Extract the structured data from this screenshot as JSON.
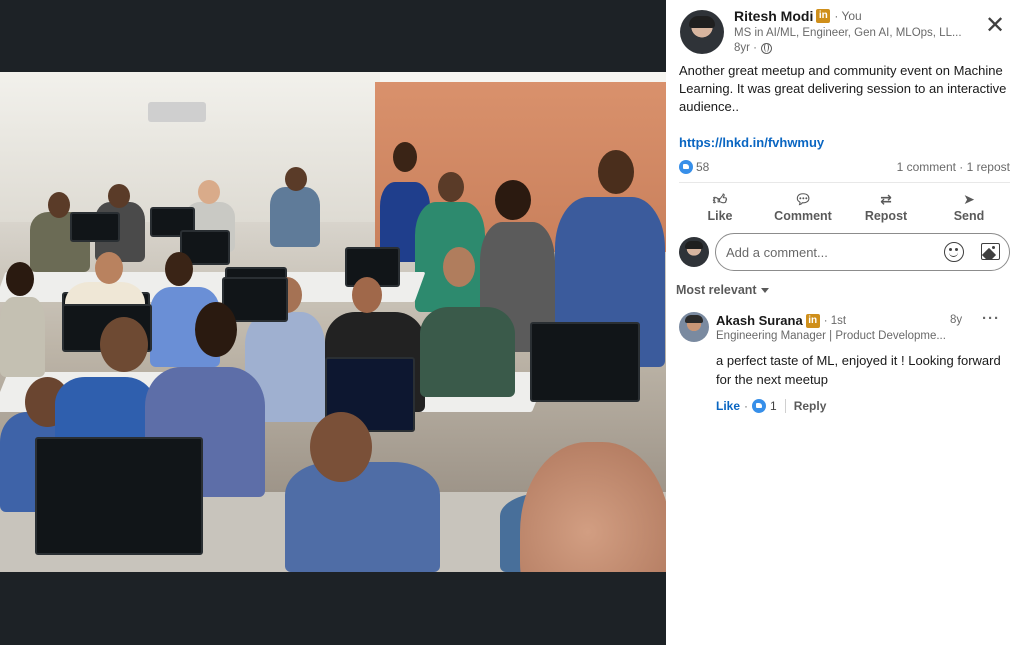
{
  "post": {
    "author": {
      "name": "Ritesh Modi",
      "badge": "in",
      "relation": "· You",
      "headline": "MS in AI/ML, Engineer, Gen AI, MLOps, LL...",
      "time": "8yr ·"
    },
    "text": "Another great meetup and community event on Machine Learning. It was great delivering session to an interactive audience..",
    "link": "https://lnkd.in/fvhwmuy",
    "reactions_count": "58",
    "comments_reposts": "1 comment · 1 repost",
    "actions": {
      "like": "Like",
      "comment": "Comment",
      "repost": "Repost",
      "send": "Send"
    },
    "comment_placeholder": "Add a comment...",
    "sort_label": "Most relevant"
  },
  "comment": {
    "name": "Akash Surana",
    "badge": "in",
    "degree": "· 1st",
    "headline": "Engineering Manager | Product Developme...",
    "time": "8y",
    "more": "···",
    "text": "a perfect taste of ML, enjoyed it ! Looking forward for the next meetup",
    "like_label": "Like",
    "separator": "·",
    "like_count": "1",
    "reply_label": "Reply"
  },
  "colors": {
    "link": "#0a66c2",
    "like_bubble": "#378fe9",
    "premium_badge": "#cf8f1b",
    "viewer_bg": "#1d2226"
  },
  "icons": [
    "close-icon",
    "globe-icon",
    "like-reaction-icon",
    "like-icon",
    "comment-icon",
    "repost-icon",
    "send-icon",
    "emoji-icon",
    "image-icon",
    "caret-down-icon",
    "more-icon"
  ]
}
